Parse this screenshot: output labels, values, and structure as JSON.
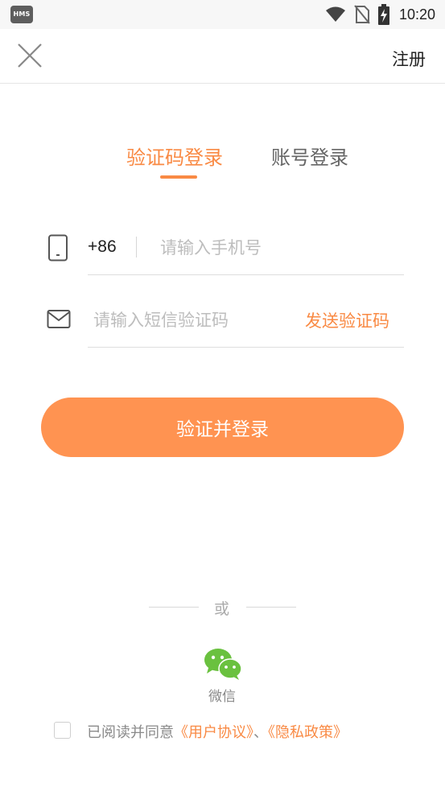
{
  "status_bar": {
    "badge": "HMS",
    "time": "10:20",
    "icons": [
      "wifi-icon",
      "no-sim-icon",
      "battery-charging-icon"
    ]
  },
  "header": {
    "close_icon": "close-icon",
    "register_label": "注册"
  },
  "tabs": [
    {
      "label": "验证码登录",
      "active": true
    },
    {
      "label": "账号登录",
      "active": false
    }
  ],
  "form": {
    "phone_icon": "phone-icon",
    "country_code": "+86",
    "phone_placeholder": "请输入手机号",
    "phone_value": "",
    "mail_icon": "mail-icon",
    "code_placeholder": "请输入短信验证码",
    "code_value": "",
    "send_code_label": "发送验证码",
    "submit_label": "验证并登录"
  },
  "divider": {
    "label": "或"
  },
  "social": {
    "wechat_icon": "wechat-icon",
    "wechat_label": "微信"
  },
  "agreement": {
    "checked": false,
    "prefix": "已阅读并同意",
    "user_agreement": "《用户协议》",
    "separator": "、",
    "privacy_policy": "《隐私政策》"
  },
  "colors": {
    "accent": "#f98a44",
    "button_bg": "#ff9351",
    "wechat_green": "#6ac13f"
  }
}
